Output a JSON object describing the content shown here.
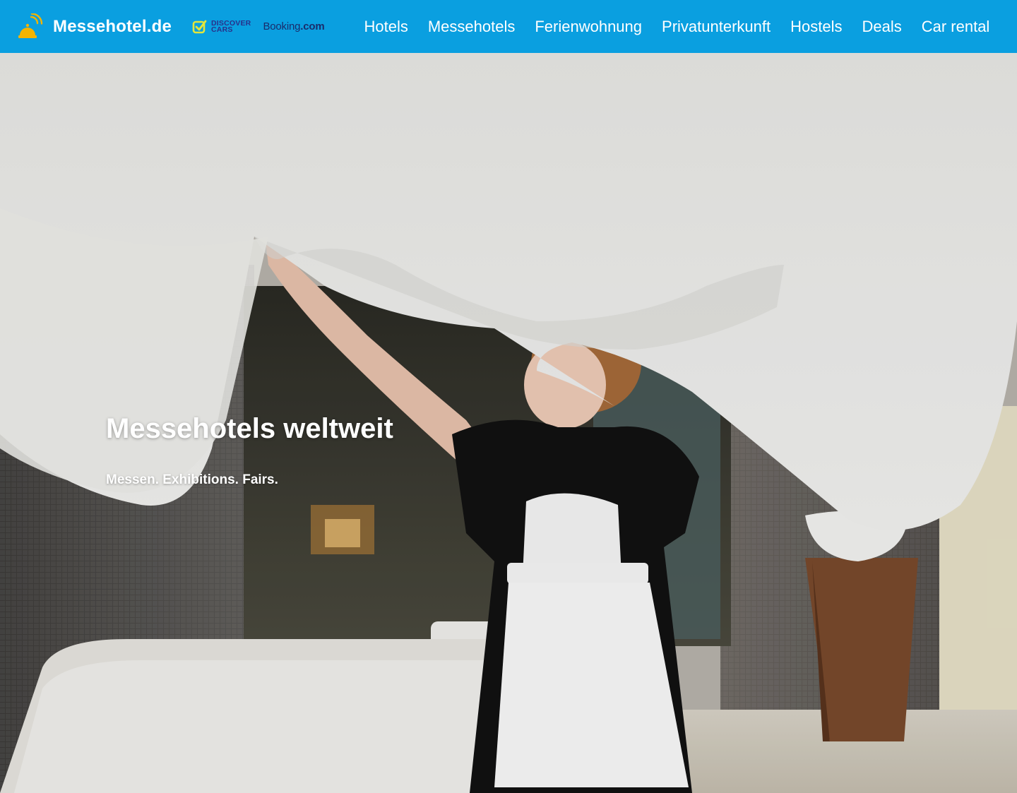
{
  "header": {
    "brand_name": "Messehotel.de",
    "brand_icon": "hotel-bell-icon",
    "partners": {
      "discovercars_line1": "DISCOVER",
      "discovercars_line2": "CARS",
      "booking_main": "Booking",
      "booking_suffix": ".com"
    },
    "nav": [
      "Hotels",
      "Messehotels",
      "Ferienwohnung",
      "Privatunterkunft",
      "Hostels",
      "Deals",
      "Car rental"
    ]
  },
  "hero": {
    "title": "Messehotels weltweit",
    "subtitle": "Messen. Exhibitions. Fairs."
  },
  "colors": {
    "header_bg": "#0a9fe0",
    "brand_icon": "#f4b400",
    "discovercars_check": "#e2e63c",
    "discovercars_text": "#29318a",
    "booking_text": "#1a2c6b"
  }
}
